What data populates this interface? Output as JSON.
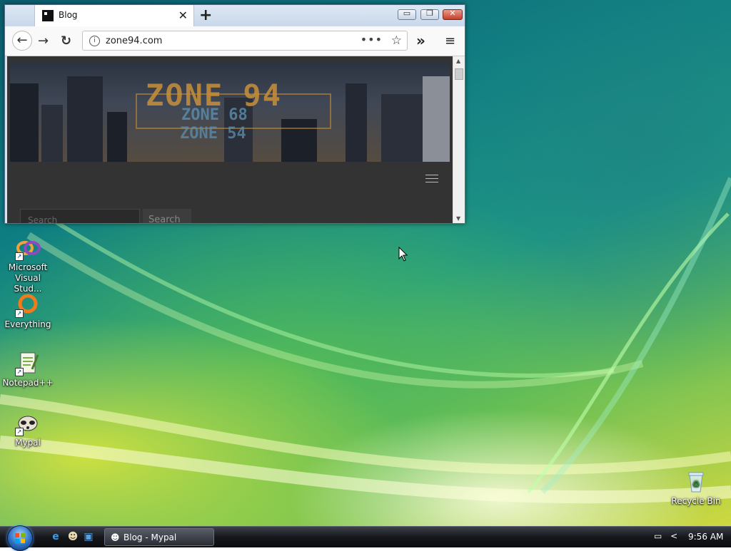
{
  "browser": {
    "tab_title": "Blog",
    "tab_close": "✕",
    "new_tab": "+",
    "url": "zone94.com",
    "url_dots": "•••",
    "star": "☆",
    "overflow": "»",
    "menu": "≡",
    "back": "←",
    "forward": "→",
    "reload": "↻",
    "info": "i",
    "window_min": "▭",
    "window_max": "❐",
    "window_close": "✕",
    "page": {
      "logo_main": "ZONE 94",
      "logo_sub1": "ZONE 68",
      "logo_sub2": "ZONE 54",
      "search_placeholder": "Search",
      "search_button": "Search"
    }
  },
  "desktop_icons": [
    {
      "label": "Microsoft Visual Stud...",
      "icon": "visual-studio-icon"
    },
    {
      "label": "Everything",
      "icon": "everything-icon"
    },
    {
      "label": "Notepad++",
      "icon": "notepadpp-icon"
    },
    {
      "label": "Mypal",
      "icon": "mypal-icon"
    },
    {
      "label": "Recycle Bin",
      "icon": "recycle-bin-icon"
    }
  ],
  "taskbar": {
    "active_window": "Blog - Mypal",
    "tray_arrow": "<",
    "clock": "9:56 AM"
  },
  "colors": {
    "accent_close": "#c6402a",
    "logo_orange": "#c8903a",
    "logo_blue": "#5d8fb0"
  }
}
